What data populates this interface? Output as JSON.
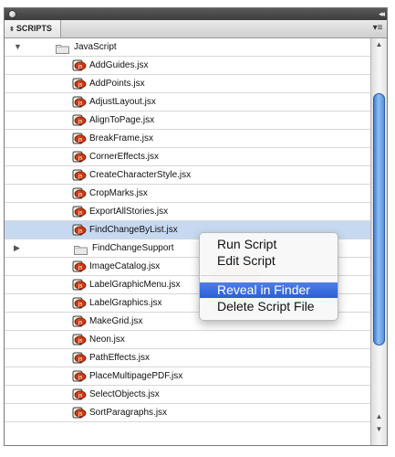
{
  "panel": {
    "tab_label": "SCRIPTS",
    "menu_icon": "panel-menu-icon"
  },
  "tree": {
    "root_folder": "JavaScript",
    "items": [
      {
        "label": "AddGuides.jsx"
      },
      {
        "label": "AddPoints.jsx"
      },
      {
        "label": "AdjustLayout.jsx"
      },
      {
        "label": "AlignToPage.jsx"
      },
      {
        "label": "BreakFrame.jsx"
      },
      {
        "label": "CornerEffects.jsx"
      },
      {
        "label": "CreateCharacterStyle.jsx"
      },
      {
        "label": "CropMarks.jsx"
      },
      {
        "label": "ExportAllStories.jsx"
      },
      {
        "label": "FindChangeByList.jsx",
        "selected": true
      },
      {
        "label": "FindChangeSupport",
        "type": "folder"
      },
      {
        "label": "ImageCatalog.jsx"
      },
      {
        "label": "LabelGraphicMenu.jsx"
      },
      {
        "label": "LabelGraphics.jsx"
      },
      {
        "label": "MakeGrid.jsx"
      },
      {
        "label": "Neon.jsx"
      },
      {
        "label": "PathEffects.jsx"
      },
      {
        "label": "PlaceMultipagePDF.jsx"
      },
      {
        "label": "SelectObjects.jsx"
      },
      {
        "label": "SortParagraphs.jsx"
      }
    ]
  },
  "context_menu": {
    "items": [
      {
        "label": "Run Script"
      },
      {
        "label": "Edit Script"
      },
      {
        "label": "Reveal in Finder",
        "highlighted": true
      },
      {
        "label": "Delete Script File"
      }
    ]
  },
  "colors": {
    "selection": "#c6d9f0",
    "menu_highlight": "#2a5fd6",
    "scroll_thumb": "#4d8ad8"
  }
}
